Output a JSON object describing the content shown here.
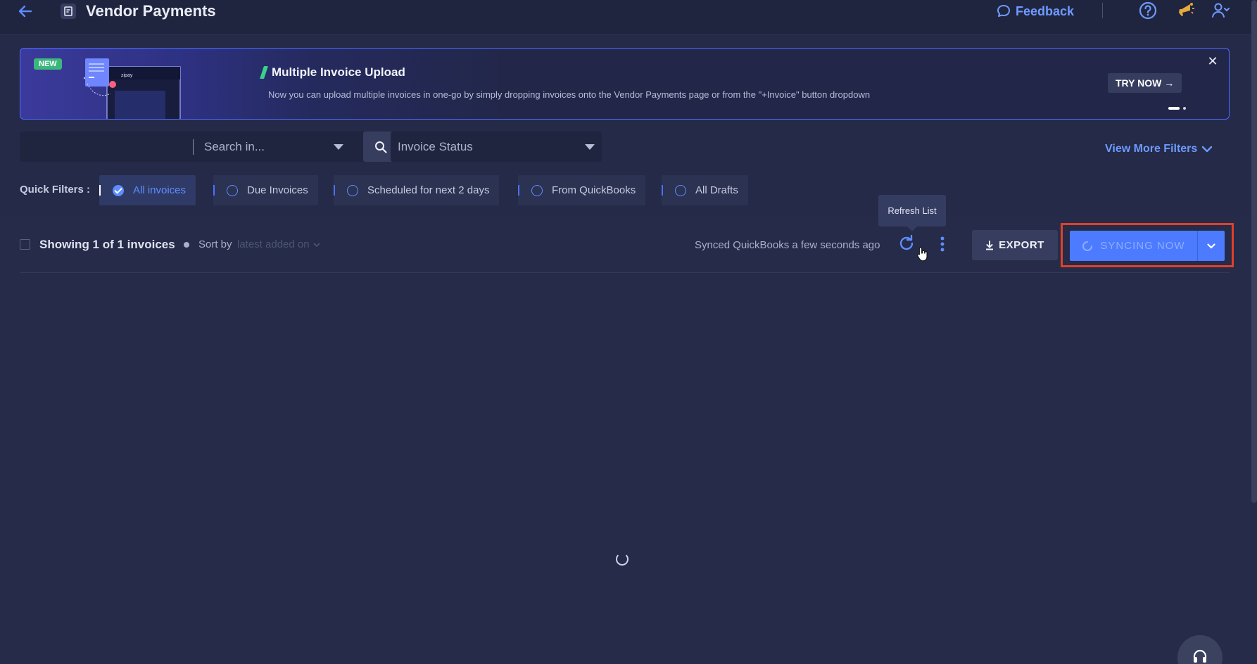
{
  "header": {
    "title": "Vendor Payments",
    "feedback_label": "Feedback"
  },
  "banner": {
    "badge": "NEW",
    "title": "Multiple Invoice Upload",
    "description": "Now you can upload multiple invoices in one-go by simply dropping invoices onto the Vendor Payments page or from the \"+Invoice\" button dropdown",
    "cta_label": "TRY NOW →",
    "close_label": "✕"
  },
  "search": {
    "placeholder": "",
    "search_in_label": "Search in...",
    "status_label": "Invoice Status",
    "more_filters_label": "View More Filters"
  },
  "quick_filters": {
    "label": "Quick Filters :",
    "items": [
      {
        "label": "All invoices",
        "active": true
      },
      {
        "label": "Due Invoices",
        "active": false
      },
      {
        "label": "Scheduled for next 2 days",
        "active": false
      },
      {
        "label": "From QuickBooks",
        "active": false
      },
      {
        "label": "All Drafts",
        "active": false
      }
    ]
  },
  "list": {
    "showing_label": "Showing 1 of 1 invoices",
    "sort_by_label": "Sort by",
    "sort_value": "latest added on",
    "synced_label": "Synced QuickBooks a few seconds ago",
    "refresh_tooltip": "Refresh List",
    "export_label": "EXPORT",
    "sync_label": "SYNCING NOW"
  },
  "colors": {
    "background": "#242a47",
    "accent": "#4c7bff",
    "highlight_box": "#e0402a",
    "new_badge": "#3bb77e"
  }
}
